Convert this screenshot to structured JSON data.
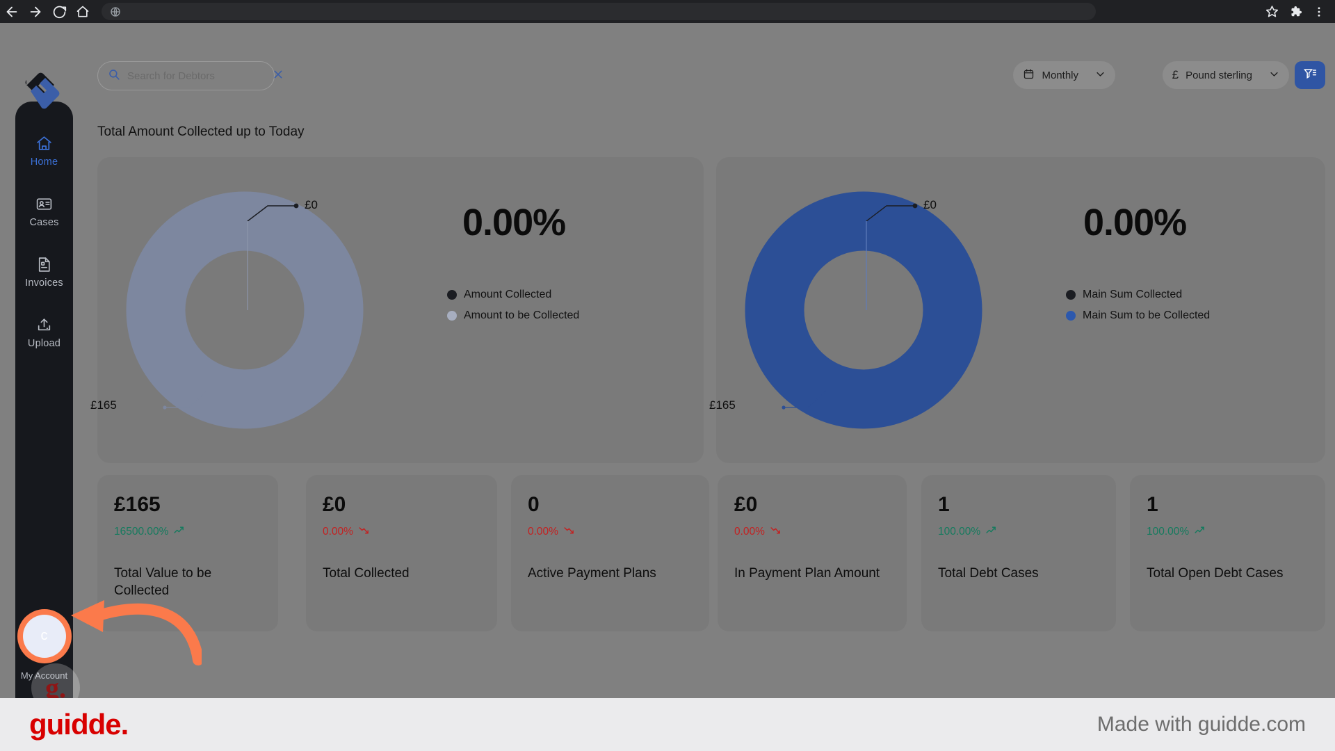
{
  "browser": {
    "back_icon": "arrow-left-icon",
    "forward_icon": "arrow-right-icon",
    "reload_icon": "reload-icon",
    "home_icon": "home-icon",
    "omnibox_icon": "globe-icon",
    "omnibox_value": "",
    "bookmark_icon": "star-icon",
    "extensions_icon": "puzzle-icon",
    "menu_icon": "three-dots-icon"
  },
  "brand": {
    "logo_name": "app-logo"
  },
  "search": {
    "placeholder": "Search for Debtors",
    "value": "",
    "icon": "search-icon",
    "clear_icon": "close-icon"
  },
  "toolbar": {
    "period": {
      "label": "Monthly",
      "icon": "calendar-icon",
      "chevron": "chevron-down-icon"
    },
    "currency": {
      "symbol": "£",
      "label": "Pound sterling",
      "chevron": "chevron-down-icon"
    },
    "filter": {
      "icon": "filter-icon"
    }
  },
  "sidebar": {
    "items": [
      {
        "label": "Home",
        "icon": "home-icon",
        "active": true
      },
      {
        "label": "Cases",
        "icon": "id-card-icon",
        "active": false
      },
      {
        "label": "Invoices",
        "icon": "document-icon",
        "active": false
      },
      {
        "label": "Upload",
        "icon": "upload-icon",
        "active": false
      }
    ],
    "avatar": {
      "initial": "c",
      "sub_label": "My Account"
    }
  },
  "main": {
    "page_title": "Total Amount Collected up to Today"
  },
  "kpis": [
    {
      "value": "£165",
      "delta": "16500.00%",
      "direction": "up",
      "caption": "Total Value to be Collected"
    },
    {
      "value": "£0",
      "delta": "0.00%",
      "direction": "down",
      "caption": "Total Collected"
    },
    {
      "value": "0",
      "delta": "0.00%",
      "direction": "down",
      "caption": "Active Payment Plans"
    },
    {
      "value": "£0",
      "delta": "0.00%",
      "direction": "down",
      "caption": "In Payment Plan Amount"
    },
    {
      "value": "1",
      "delta": "100.00%",
      "direction": "up",
      "caption": "Total Debt Cases"
    },
    {
      "value": "1",
      "delta": "100.00%",
      "direction": "up",
      "caption": "Total Open Debt Cases"
    }
  ],
  "colors": {
    "accent_blue": "#2f55a4",
    "donut_muted": "#7d879f",
    "donut_blue": "#2c4f96",
    "legend_dark": "#1b1d22",
    "up_green": "#157a5e",
    "down_red": "#c32121",
    "annotation_orange": "#fb7a4b",
    "guidde_red": "#d80000"
  },
  "chart_data": [
    {
      "type": "pie",
      "title": "Amount Collected donut",
      "categories": [
        "Amount Collected",
        "Amount to be Collected"
      ],
      "values": [
        0,
        165
      ],
      "data_labels": [
        "£0",
        "£165"
      ],
      "center_text": "0.00%",
      "slice_colors": [
        "#1b1d22",
        "#7d879f"
      ],
      "legend": [
        "Amount Collected",
        "Amount to be Collected"
      ],
      "legend_position": "right",
      "currency": "£"
    },
    {
      "type": "pie",
      "title": "Main Sum Collected donut",
      "categories": [
        "Main Sum Collected",
        "Main Sum to be Collected"
      ],
      "values": [
        0,
        165
      ],
      "data_labels": [
        "£0",
        "£165"
      ],
      "center_text": "0.00%",
      "slice_colors": [
        "#1b1d22",
        "#2c4f96"
      ],
      "legend": [
        "Main Sum Collected",
        "Main Sum to be Collected"
      ],
      "legend_position": "right",
      "currency": "£"
    }
  ],
  "footer": {
    "logo_text": "guidde.",
    "made_with": "Made with guidde.com"
  }
}
